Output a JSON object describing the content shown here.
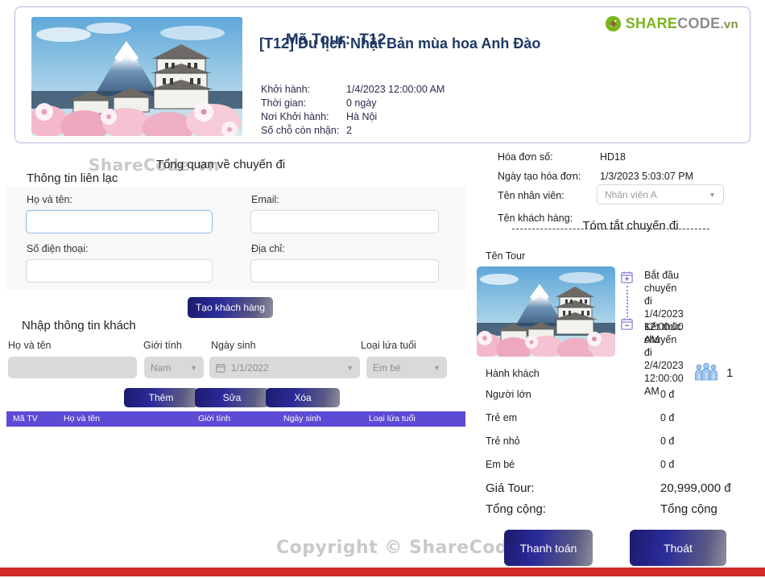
{
  "brand": {
    "logo_share": "SHARE",
    "logo_code": "CODE",
    "logo_vn": ".vn",
    "logo_icon": "recycle-logo-icon",
    "watermark": "ShareCode.vn",
    "copyright": "Copyright © ShareCode.vn",
    "green": "#7bb51f",
    "grey": "#8c8c8c"
  },
  "header": {
    "tour_code_label": "Mã Tour:",
    "tour_code_value": "T12",
    "tour_title": "[T12] Du lịch Nhật Bản mùa hoa Anh Đào",
    "meta": [
      {
        "label": "Khởi hành:",
        "value": "1/4/2023 12:00:00 AM"
      },
      {
        "label": "Thời gian:",
        "value": "0 ngày"
      },
      {
        "label": "Nơi Khởi hành:",
        "value": "Hà Nội"
      },
      {
        "label": "Số chỗ còn nhận:",
        "value": "2"
      }
    ],
    "image_alt": "mount-fuji-castle-cherry-blossom"
  },
  "left": {
    "overview_title": "Tổng quan về chuyến đi",
    "contact_title": "Thông tin liên lạc",
    "fields": {
      "name_label": "Họ và tên:",
      "name_value": "",
      "email_label": "Email:",
      "email_value": "",
      "phone_label": "Số điện thoại:",
      "phone_value": "",
      "address_label": "Địa chỉ:",
      "address_value": ""
    },
    "create_customer_button": "Tạo khách hàng",
    "guest_title": "Nhập thông tin khách",
    "guest_labels": {
      "name": "Họ và tên",
      "gender": "Giới tính",
      "dob": "Ngày sinh",
      "age_type": "Loại lứa tuổi"
    },
    "guest_values": {
      "name": "",
      "gender": "Nam",
      "dob": "1/1/2022",
      "age_type": "Em bé"
    },
    "actions": {
      "add": "Thêm",
      "edit": "Sửa",
      "delete": "Xóa"
    },
    "table_headers": [
      "Mã TV",
      "Họ và tên",
      "Giới tính",
      "Ngày sinh",
      "Loại lứa tuổi"
    ],
    "table_rows": []
  },
  "right": {
    "invoice": [
      {
        "label": "Hóa đơn số:",
        "value": "HD18"
      },
      {
        "label": "Ngày tạo hóa đơn:",
        "value": "1/3/2023 5:03:07 PM"
      },
      {
        "label": "Tên nhân viên:",
        "value": "Nhân viên A"
      },
      {
        "label": "Tên khách hàng:",
        "value": ""
      }
    ],
    "employee_select_value": "Nhân viên A",
    "summary_title": "Tóm tắt chuyến đi",
    "tour_name_label": "Tên Tour",
    "timeline": [
      {
        "label": "Bắt đầu chuyến đi",
        "value": "1/4/2023 12:00:00 AM",
        "icon": "calendar-plus-icon"
      },
      {
        "label": "Kết thúc chuyến đi",
        "value": "2/4/2023 12:00:00 AM",
        "icon": "calendar-minus-icon"
      }
    ],
    "passenger_label": "Hành khách",
    "passenger_count": "1",
    "prices": [
      {
        "label": "Người lớn",
        "value": "0 đ"
      },
      {
        "label": "Trẻ em",
        "value": "0 đ"
      },
      {
        "label": "Trẻ nhỏ",
        "value": "0 đ"
      },
      {
        "label": "Em bé",
        "value": "0 đ"
      }
    ],
    "tour_price_label": "Giá Tour:",
    "tour_price_value": "20,999,000 đ",
    "total_label": "Tổng cộng:",
    "total_value": "Tổng cộng"
  },
  "footer": {
    "pay_button": "Thanh toán",
    "exit_button": "Thoát",
    "bar_color": "#d32b27"
  }
}
